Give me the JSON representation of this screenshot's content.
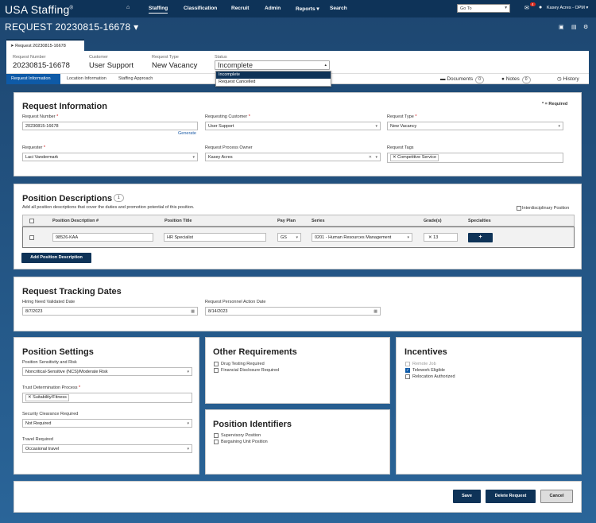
{
  "app": {
    "logo": "USA Staffing",
    "logo_mark": "®",
    "nav": [
      {
        "label": "Staffing"
      },
      {
        "label": "Classification"
      },
      {
        "label": "Recruit"
      },
      {
        "label": "Admin"
      },
      {
        "label": "Reports ▾"
      },
      {
        "label": "Search"
      }
    ],
    "goto_placeholder": "Go To",
    "notification_count": "4",
    "user": "Kasey Acres - OPM ▾"
  },
  "request": {
    "title": "REQUEST 20230815-16678 ▾",
    "tab_label": "Request 20230815-16678",
    "summary": {
      "number_label": "Request Number",
      "number": "20230815-16678",
      "customer_label": "Customer",
      "customer": "User Support",
      "type_label": "Request Type",
      "type": "New Vacancy",
      "status_label": "Status",
      "status": "Incomplete",
      "status_options": [
        "Incomplete",
        "Request Cancelled"
      ]
    },
    "steps": [
      "Request Information",
      "Location Information",
      "Staffing Approach"
    ],
    "tools": {
      "documents": "Documents",
      "documents_count": "0",
      "notes": "Notes",
      "notes_count": "0",
      "history": "History"
    }
  },
  "info": {
    "title": "Request Information",
    "required_note": "* = Required",
    "request_number_label": "Request Number",
    "request_number": "20230815-16678",
    "generate": "Generate",
    "requesting_customer_label": "Requesting Customer",
    "requesting_customer": "User Support",
    "request_type_label": "Request Type",
    "request_type": "New Vacancy",
    "requester_label": "Requester",
    "requester": "Laci Vandermark",
    "process_owner_label": "Request Process Owner",
    "process_owner": "Kasey Acres",
    "tags_label": "Request Tags",
    "tag": "Competitive Service"
  },
  "pd": {
    "title": "Position Descriptions",
    "count": "1",
    "desc": "Add all position descriptions that cover the duties and promotion potential of this position.",
    "interdisciplinary": "Interdisciplinary Position",
    "headers": [
      "Position Description #",
      "Position Title",
      "Pay Plan",
      "Series",
      "Grade(s)",
      "Specialties"
    ],
    "row": {
      "number": "98526-KAA",
      "title": "HR Specialist",
      "pay_plan": "GS",
      "series": "0201 - Human Resources Management",
      "grade": "13"
    },
    "add_button": "Add Position Description"
  },
  "tracking": {
    "title": "Request Tracking Dates",
    "hiring_label": "Hiring Need Validated Date",
    "hiring": "8/7/2023",
    "rpa_label": "Request Personnel Action Date",
    "rpa": "8/14/2023"
  },
  "settings": {
    "title": "Position Settings",
    "sensitivity_label": "Position Sensitivity and Risk",
    "sensitivity": "Noncritical-Sensitive (NCS)/Moderate Risk",
    "trust_label": "Trust Determination Process",
    "trust_tag": "Suitability/Fitness",
    "clearance_label": "Security Clearance Required",
    "clearance": "Not Required",
    "travel_label": "Travel Required",
    "travel": "Occasional travel"
  },
  "other": {
    "title": "Other Requirements",
    "items": [
      "Drug Testing Required",
      "Financial Disclosure Required"
    ]
  },
  "identifiers": {
    "title": "Position Identifiers",
    "items": [
      "Supervisory Position",
      "Bargaining Unit Position"
    ]
  },
  "incentives": {
    "title": "Incentives",
    "items": [
      "Remote Job",
      "Telework Eligible",
      "Relocation Authorized"
    ]
  },
  "footer": {
    "save": "Save",
    "delete": "Delete Request",
    "cancel": "Cancel"
  },
  "colors": {
    "nav": "#0e3358",
    "accent": "#0e5aa7",
    "required": "#cc0000"
  }
}
